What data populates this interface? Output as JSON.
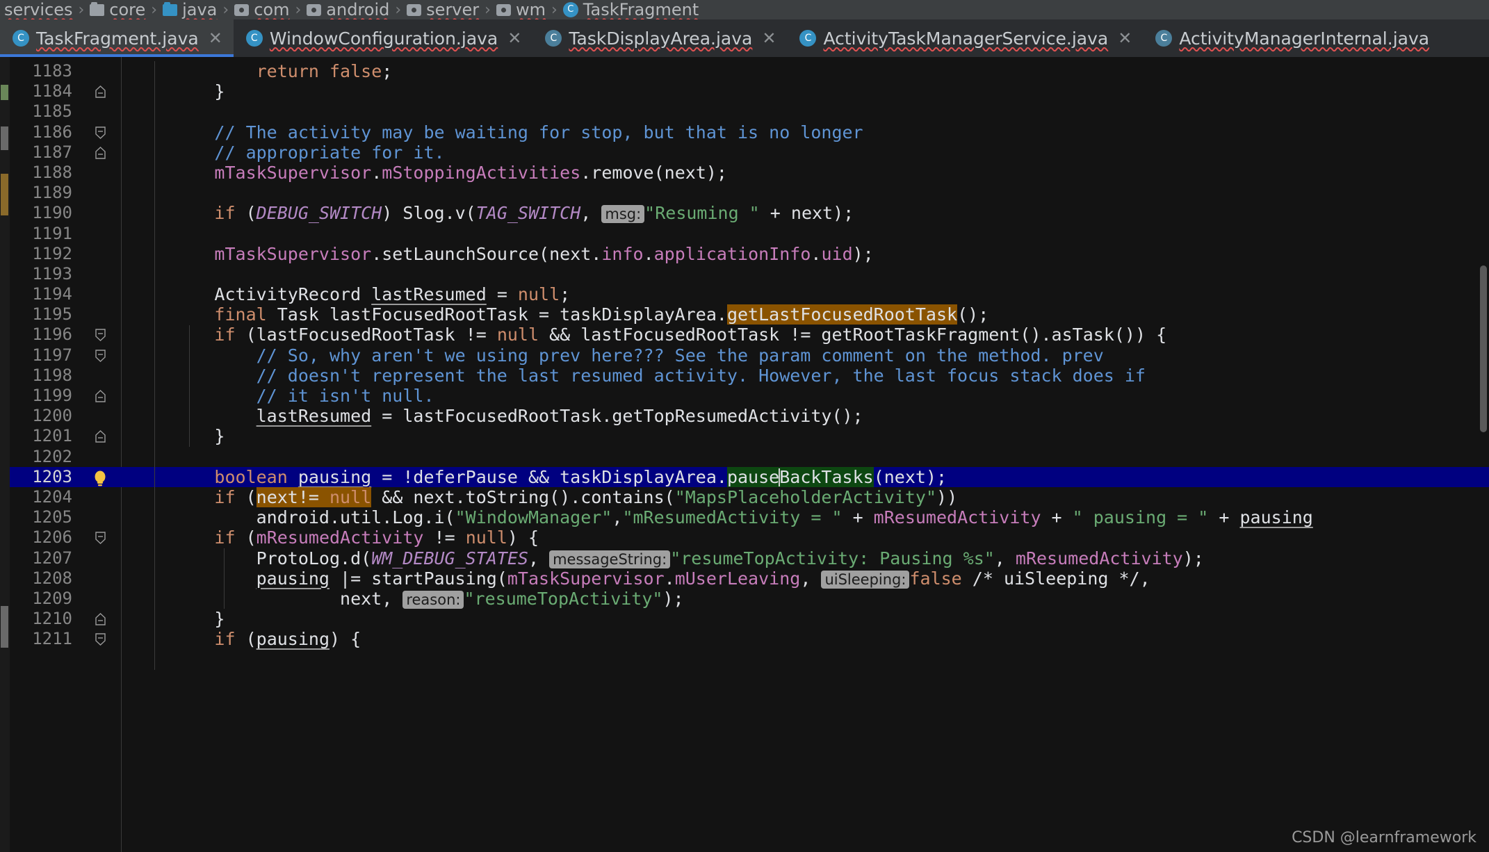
{
  "breadcrumb": {
    "items": [
      {
        "label": "services",
        "icon": "none"
      },
      {
        "label": "core",
        "icon": "folder-icon"
      },
      {
        "label": "java",
        "icon": "folder-icon-blue"
      },
      {
        "label": "com",
        "icon": "package-icon"
      },
      {
        "label": "android",
        "icon": "package-icon"
      },
      {
        "label": "server",
        "icon": "package-icon"
      },
      {
        "label": "wm",
        "icon": "package-icon"
      },
      {
        "label": "TaskFragment",
        "icon": "class-icon"
      }
    ],
    "separator": "›"
  },
  "tabs": [
    {
      "label": "TaskFragment.java",
      "icon": "java-class-icon",
      "active": true,
      "closable": true
    },
    {
      "label": "WindowConfiguration.java",
      "icon": "java-class-icon",
      "active": false,
      "closable": true
    },
    {
      "label": "TaskDisplayArea.java",
      "icon": "java-class-icon-ghost",
      "active": false,
      "closable": true
    },
    {
      "label": "ActivityTaskManagerService.java",
      "icon": "java-class-icon",
      "active": false,
      "closable": true
    },
    {
      "label": "ActivityManagerInternal.java",
      "icon": "java-class-icon-ghost",
      "active": false,
      "closable": false
    }
  ],
  "tab_close_glyph": "✕",
  "editor": {
    "selected_line_number": 1203,
    "caret_line": 1203,
    "gutter_icon_bulb": "intention-bulb-icon",
    "lines": [
      {
        "num": "1183",
        "fold": "none",
        "text": "            return false;"
      },
      {
        "num": "1184",
        "fold": "end",
        "text": "        }"
      },
      {
        "num": "1185",
        "fold": "none",
        "text": ""
      },
      {
        "num": "1186",
        "fold": "start",
        "text": "        // The activity may be waiting for stop, but that is no longer"
      },
      {
        "num": "1187",
        "fold": "end",
        "text": "        // appropriate for it."
      },
      {
        "num": "1188",
        "fold": "none",
        "text": "        mTaskSupervisor.mStoppingActivities.remove(next);"
      },
      {
        "num": "1189",
        "fold": "none",
        "text": ""
      },
      {
        "num": "1190",
        "fold": "none",
        "text": "        if (DEBUG_SWITCH) Slog.v(TAG_SWITCH, msg:\"Resuming \" + next);"
      },
      {
        "num": "1191",
        "fold": "none",
        "text": ""
      },
      {
        "num": "1192",
        "fold": "none",
        "text": "        mTaskSupervisor.setLaunchSource(next.info.applicationInfo.uid);"
      },
      {
        "num": "1193",
        "fold": "none",
        "text": ""
      },
      {
        "num": "1194",
        "fold": "none",
        "text": "        ActivityRecord lastResumed = null;"
      },
      {
        "num": "1195",
        "fold": "none",
        "text": "        final Task lastFocusedRootTask = taskDisplayArea.getLastFocusedRootTask();"
      },
      {
        "num": "1196",
        "fold": "start",
        "text": "        if (lastFocusedRootTask != null && lastFocusedRootTask != getRootTaskFragment().asTask()) {"
      },
      {
        "num": "1197",
        "fold": "start",
        "text": "            // So, why aren't we using prev here??? See the param comment on the method. prev"
      },
      {
        "num": "1198",
        "fold": "none",
        "text": "            // doesn't represent the last resumed activity. However, the last focus stack does if"
      },
      {
        "num": "1199",
        "fold": "end",
        "text": "            // it isn't null."
      },
      {
        "num": "1200",
        "fold": "none",
        "text": "            lastResumed = lastFocusedRootTask.getTopResumedActivity();"
      },
      {
        "num": "1201",
        "fold": "end",
        "text": "        }"
      },
      {
        "num": "1202",
        "fold": "none",
        "text": ""
      },
      {
        "num": "1203",
        "fold": "bulb",
        "text": "        boolean pausing = !deferPause && taskDisplayArea.pauseBackTasks(next);"
      },
      {
        "num": "1204",
        "fold": "none",
        "text": "        if (next!= null && next.toString().contains(\"MapsPlaceholderActivity\"))"
      },
      {
        "num": "1205",
        "fold": "none",
        "text": "            android.util.Log.i(\"WindowManager\",\"mResumedActivity = \" + mResumedActivity + \" pausing = \" + pausing"
      },
      {
        "num": "1206",
        "fold": "start",
        "text": "        if (mResumedActivity != null) {"
      },
      {
        "num": "1207",
        "fold": "none",
        "text": "            ProtoLog.d(WM_DEBUG_STATES, messageString:\"resumeTopActivity: Pausing %s\", mResumedActivity);"
      },
      {
        "num": "1208",
        "fold": "none",
        "text": "            pausing |= startPausing(mTaskSupervisor.mUserLeaving, uiSleeping:false /* uiSleeping */,"
      },
      {
        "num": "1209",
        "fold": "none",
        "text": "                    next, reason:\"resumeTopActivity\");"
      },
      {
        "num": "1210",
        "fold": "end",
        "text": "        }"
      },
      {
        "num": "1211",
        "fold": "start",
        "text": "        if (pausing) {"
      }
    ],
    "param_hints": [
      "msg:",
      "messageString:",
      "uiSleeping:",
      "reason:"
    ],
    "highlighted_occurrences": [
      {
        "text": "getLastFocusedRootTask",
        "color": "#8a5300"
      },
      {
        "text": "next!= null",
        "color": "#8a5300"
      },
      {
        "text": "pauseBackTasks",
        "color": "#0d4711"
      }
    ]
  },
  "watermark": "CSDN @learnframework",
  "colors": {
    "editor_background": "#131313",
    "selected_line": "#000080",
    "keyword": "#cf8e6d",
    "string": "#6aab73",
    "field": "#c77dbb",
    "static_field": "#b389c5",
    "comment": "#5f94d4",
    "plain_text": "#dfe1e5",
    "gutter_text": "#868686",
    "accent": "#3c78d8"
  }
}
